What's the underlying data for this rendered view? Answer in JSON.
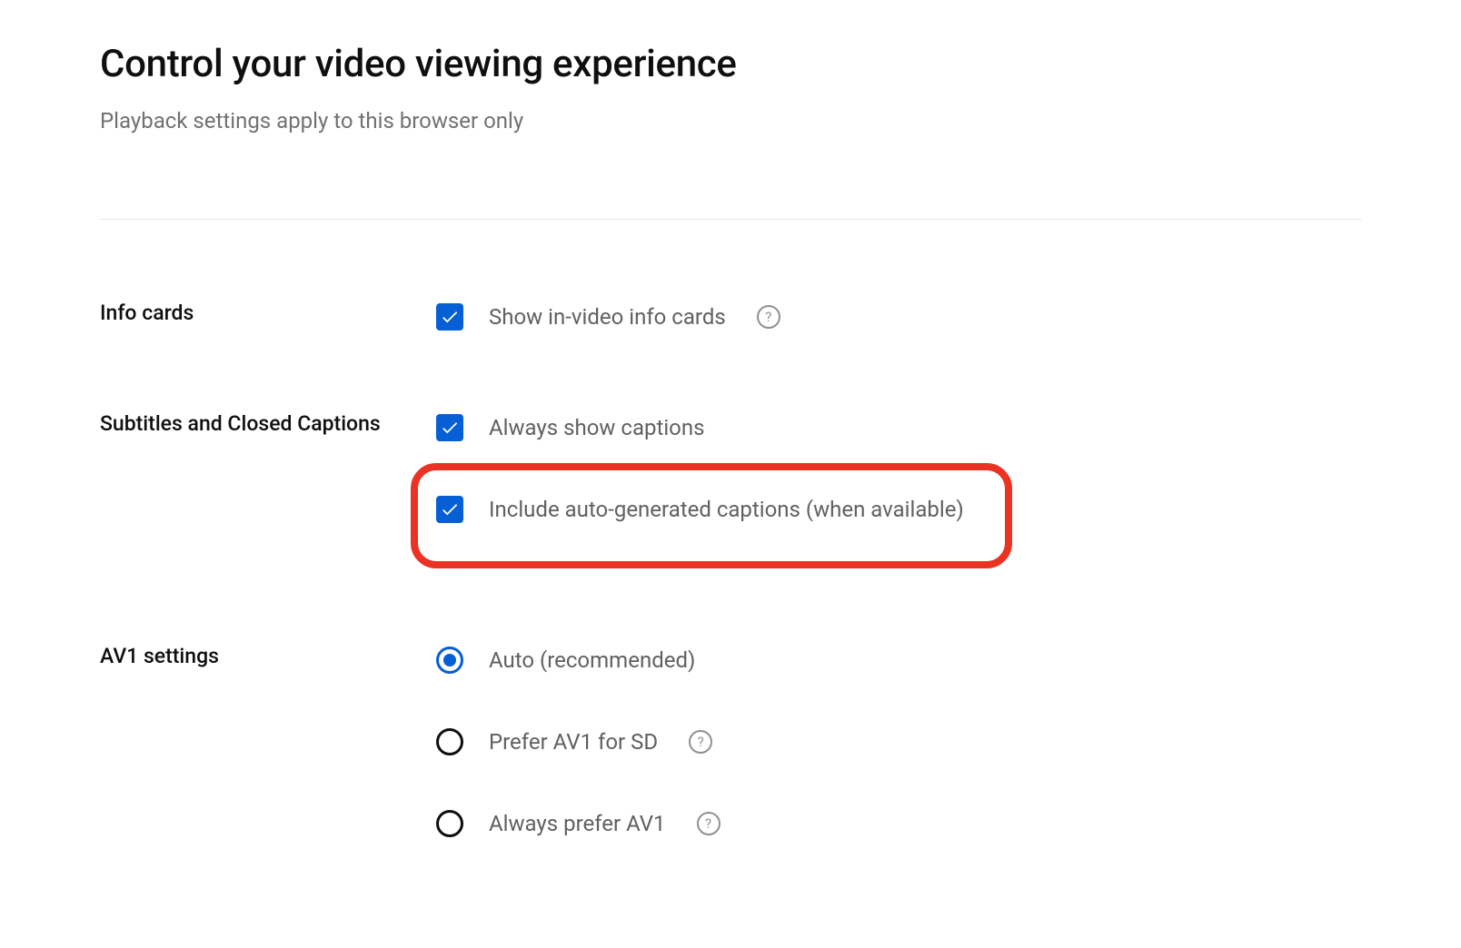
{
  "header": {
    "title": "Control your video viewing experience",
    "subtitle": "Playback settings apply to this browser only"
  },
  "sections": {
    "infoCards": {
      "label": "Info cards",
      "option": "Show in-video info cards"
    },
    "subtitles": {
      "label": "Subtitles and Closed Captions",
      "option1": "Always show captions",
      "option2": "Include auto-generated captions (when available)"
    },
    "av1": {
      "label": "AV1 settings",
      "option1": "Auto (recommended)",
      "option2": "Prefer AV1 for SD",
      "option3": "Always prefer AV1"
    }
  }
}
